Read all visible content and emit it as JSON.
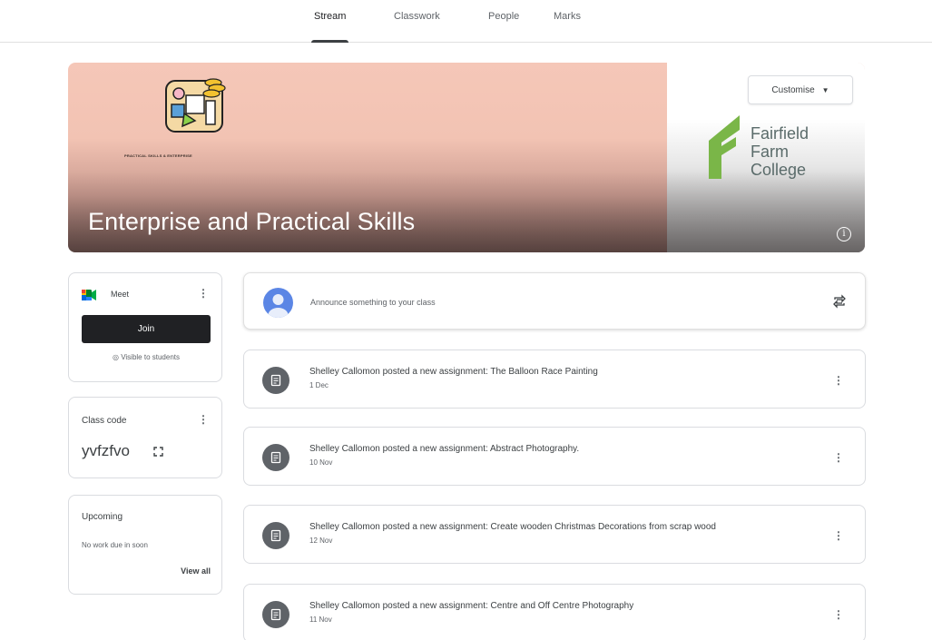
{
  "tabs": [
    {
      "label": "Stream",
      "active": true
    },
    {
      "label": "Classwork",
      "active": false
    },
    {
      "label": "People",
      "active": false
    },
    {
      "label": "Marks",
      "active": false
    }
  ],
  "banner": {
    "title": "Enterprise and Practical Skills",
    "logo_caption": "PRACTICAL SKILLS & ENTERPRISE",
    "college_line1": "Fairfield",
    "college_line2": "Farm",
    "college_line3": "College",
    "customise_label": "Customise",
    "colors": {
      "banner_top": "#f5c7b8",
      "logo_green": "#7ab648"
    }
  },
  "meet": {
    "label": "Meet",
    "join_label": "Join",
    "visible_text": "Visible to students"
  },
  "class_code": {
    "label": "Class code",
    "value": "yvfzfvo"
  },
  "upcoming": {
    "label": "Upcoming",
    "empty_text": "No work due in soon",
    "view_all_label": "View all"
  },
  "announce": {
    "placeholder": "Announce something to your class"
  },
  "posts": [
    {
      "title": "Shelley Callomon posted a new assignment: The Balloon Race Painting",
      "date": "1 Dec"
    },
    {
      "title": "Shelley Callomon posted a new assignment: Abstract Photography.",
      "date": "10 Nov"
    },
    {
      "title": "Shelley Callomon posted a new assignment: Create wooden Christmas Decorations from scrap wood",
      "date": "12 Nov"
    },
    {
      "title": "Shelley Callomon posted a new assignment: Centre and Off Centre Photography",
      "date": "11 Nov"
    }
  ]
}
